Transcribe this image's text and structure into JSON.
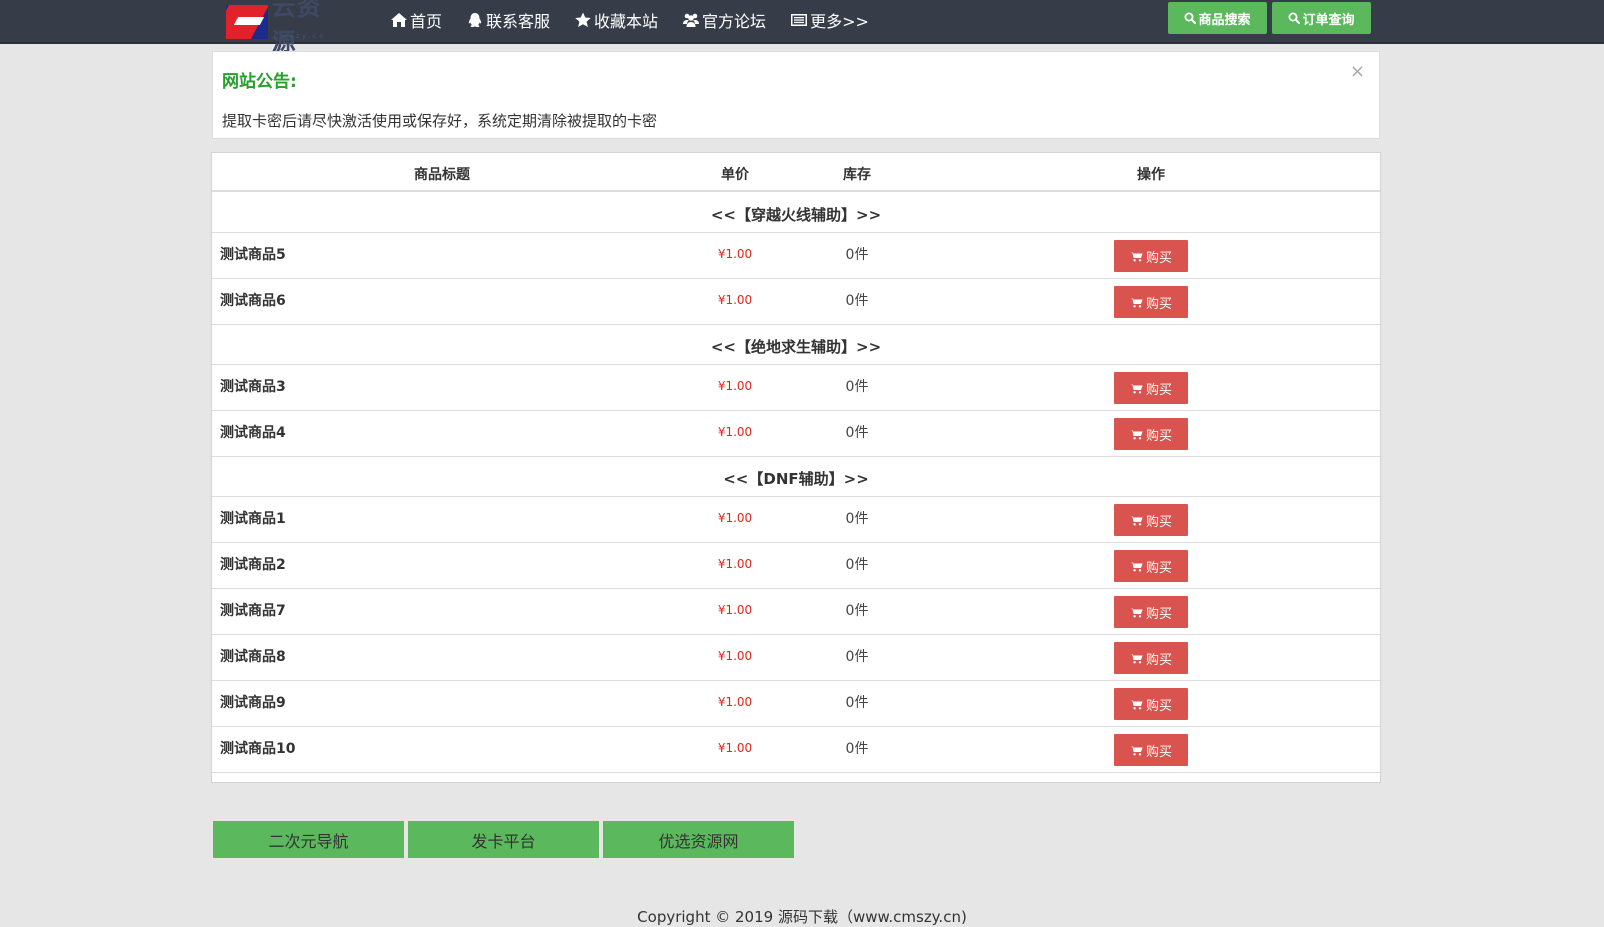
{
  "navbar": {
    "logo_text": "云资源",
    "logo_sub": "Cmszy.cn",
    "links": [
      {
        "label": "首页",
        "icon": "home-icon"
      },
      {
        "label": "联系客服",
        "icon": "qq-icon"
      },
      {
        "label": "收藏本站",
        "icon": "star-icon"
      },
      {
        "label": "官方论坛",
        "icon": "users-icon"
      },
      {
        "label": "更多>>",
        "icon": "list-icon"
      }
    ],
    "search_btn": "商品搜索",
    "order_btn": "订单查询",
    "accent": "#5cb85c",
    "background": "#363c48"
  },
  "notice": {
    "title": "网站公告:",
    "close": "×",
    "body": "提取卡密后请尽快激活使用或保存好，系统定期清除被提取的卡密"
  },
  "table": {
    "headers": {
      "title": "商品标题",
      "price": "单价",
      "stock": "库存",
      "action": "操作"
    },
    "groups": [
      {
        "label": "<<【穿越火线辅助】>>",
        "items": [
          {
            "name": "测试商品5",
            "price": "¥1.00",
            "stock": "0件",
            "action": "购买"
          },
          {
            "name": "测试商品6",
            "price": "¥1.00",
            "stock": "0件",
            "action": "购买"
          }
        ]
      },
      {
        "label": "<<【绝地求生辅助】>>",
        "items": [
          {
            "name": "测试商品3",
            "price": "¥1.00",
            "stock": "0件",
            "action": "购买"
          },
          {
            "name": "测试商品4",
            "price": "¥1.00",
            "stock": "0件",
            "action": "购买"
          }
        ]
      },
      {
        "label": "<<【DNF辅助】>>",
        "items": [
          {
            "name": "测试商品1",
            "price": "¥1.00",
            "stock": "0件",
            "action": "购买"
          },
          {
            "name": "测试商品2",
            "price": "¥1.00",
            "stock": "0件",
            "action": "购买"
          },
          {
            "name": "测试商品7",
            "price": "¥1.00",
            "stock": "0件",
            "action": "购买"
          },
          {
            "name": "测试商品8",
            "price": "¥1.00",
            "stock": "0件",
            "action": "购买"
          },
          {
            "name": "测试商品9",
            "price": "¥1.00",
            "stock": "0件",
            "action": "购买"
          },
          {
            "name": "测试商品10",
            "price": "¥1.00",
            "stock": "0件",
            "action": "购买"
          }
        ]
      }
    ],
    "price_color": "#e0261b",
    "buy_color": "#d9534f"
  },
  "footer": {
    "links": [
      "二次元导航",
      "发卡平台",
      "优选资源网"
    ],
    "copyright": "Copyright © 2019 源码下载（www.cmszy.cn)"
  }
}
